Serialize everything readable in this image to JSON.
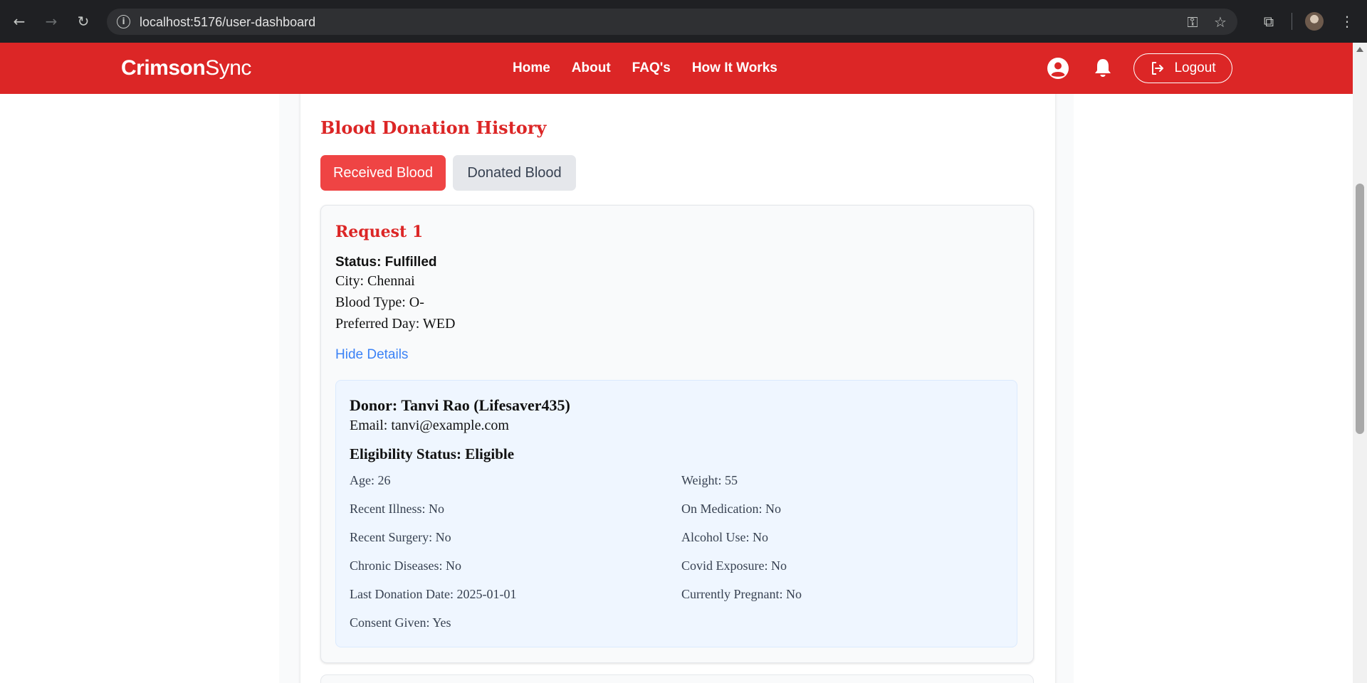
{
  "browser": {
    "url": "localhost:5176/user-dashboard"
  },
  "header": {
    "brand_bold": "Crimson",
    "brand_light": "Sync",
    "nav": [
      "Home",
      "About",
      "FAQ's",
      "How It Works"
    ],
    "logout_label": "Logout",
    "accent_color": "#dc2626"
  },
  "main": {
    "title": "Blood Donation History",
    "tabs": {
      "received": "Received Blood",
      "donated": "Donated Blood",
      "active": "Received Blood"
    },
    "request": {
      "title": "Request 1",
      "status": "Status: Fulfilled",
      "city": "City: Chennai",
      "blood_type": "Blood Type: O-",
      "preferred_day": "Preferred Day: WED",
      "toggle_label": "Hide Details",
      "donor": {
        "name": "Donor: Tanvi Rao (Lifesaver435)",
        "email": "Email: tanvi@example.com",
        "eligibility": "Eligibility Status: Eligible",
        "fields_left": [
          "Age: 26",
          "Recent Illness: No",
          "Recent Surgery: No",
          "Chronic Diseases: No",
          "Last Donation Date: 2025-01-01",
          "Consent Given: Yes"
        ],
        "fields_right": [
          "Weight: 55",
          "On Medication: No",
          "Alcohol Use: No",
          "Covid Exposure: No",
          "Currently Pregnant: No"
        ]
      }
    }
  }
}
